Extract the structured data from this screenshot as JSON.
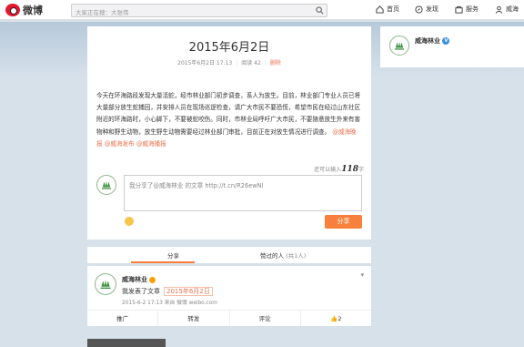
{
  "topbar": {
    "logo_text": "微博",
    "search_placeholder": "大家正在搜：大张伟",
    "nav": [
      {
        "label": "首页",
        "icon": "home-icon"
      },
      {
        "label": "发现",
        "icon": "discover-icon"
      },
      {
        "label": "服务",
        "icon": "service-icon"
      },
      {
        "label": "威海",
        "icon": "user-icon"
      }
    ]
  },
  "article": {
    "title": "2015年6月2日",
    "date": "2015年6月2日 17:13",
    "reads": "阅读 42",
    "delete_label": "删除",
    "body": "今天在环海路段发现大量活蛇，经市林业部门初步调查，系人为放生。目前，林业部门专业人员已将大量部分放生蛇捕回，并安排人员在现场巡逻检查，请广大市民不要恐慌，希望市民在经过山东社区附近的环海路时，小心脚下，不要被蛇咬伤。同时，市林业局呼吁广大市民，不要随意放生外来有害物种和野生动物，放生野生动物需要经过林业部门审批，目前正在对放生情况进行调查。",
    "tags": "@威海晚报 @威海发布 @威海播报"
  },
  "composer": {
    "counter_prefix": "还可以输入",
    "counter_value": "118",
    "counter_suffix": "字",
    "text": "我分享了@威海林业 的文章 http://t.cn/R26ewNl",
    "share_button": "分享"
  },
  "tabs": {
    "share": "分享",
    "likes": "赞过的人",
    "likes_count": "(共1人)"
  },
  "repost": {
    "author": "威海林业",
    "text": "我发表了文章",
    "link": "2015年6月2日",
    "date": "2015-6-2 17:13 来自 微博 weibo.com",
    "actions": [
      "推广",
      "转发",
      "评论",
      "2"
    ]
  },
  "sidebar": {
    "name": "威海林业"
  },
  "colors": {
    "accent": "#f7813c",
    "link": "#eb7350"
  }
}
